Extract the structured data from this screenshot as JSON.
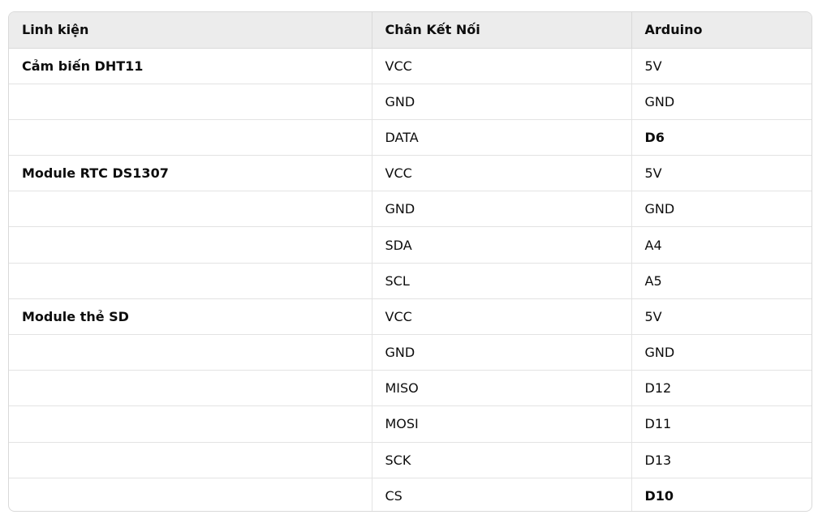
{
  "table": {
    "headers": [
      "Linh kiện",
      "Chân Kết Nối",
      "Arduino"
    ],
    "rows": [
      {
        "component": "Cảm biến DHT11",
        "pin": "VCC",
        "arduino": "5V",
        "bold": false
      },
      {
        "component": "",
        "pin": "GND",
        "arduino": "GND",
        "bold": false
      },
      {
        "component": "",
        "pin": "DATA",
        "arduino": "D6",
        "bold": true
      },
      {
        "component": "Module RTC DS1307",
        "pin": "VCC",
        "arduino": "5V",
        "bold": false
      },
      {
        "component": "",
        "pin": "GND",
        "arduino": "GND",
        "bold": false
      },
      {
        "component": "",
        "pin": "SDA",
        "arduino": "A4",
        "bold": false
      },
      {
        "component": "",
        "pin": "SCL",
        "arduino": "A5",
        "bold": false
      },
      {
        "component": "Module thẻ SD",
        "pin": "VCC",
        "arduino": "5V",
        "bold": false
      },
      {
        "component": "",
        "pin": "GND",
        "arduino": "GND",
        "bold": false
      },
      {
        "component": "",
        "pin": "MISO",
        "arduino": "D12",
        "bold": false
      },
      {
        "component": "",
        "pin": "MOSI",
        "arduino": "D11",
        "bold": false
      },
      {
        "component": "",
        "pin": "SCK",
        "arduino": "D13",
        "bold": false
      },
      {
        "component": "",
        "pin": "CS",
        "arduino": "D10",
        "bold": true
      }
    ]
  }
}
